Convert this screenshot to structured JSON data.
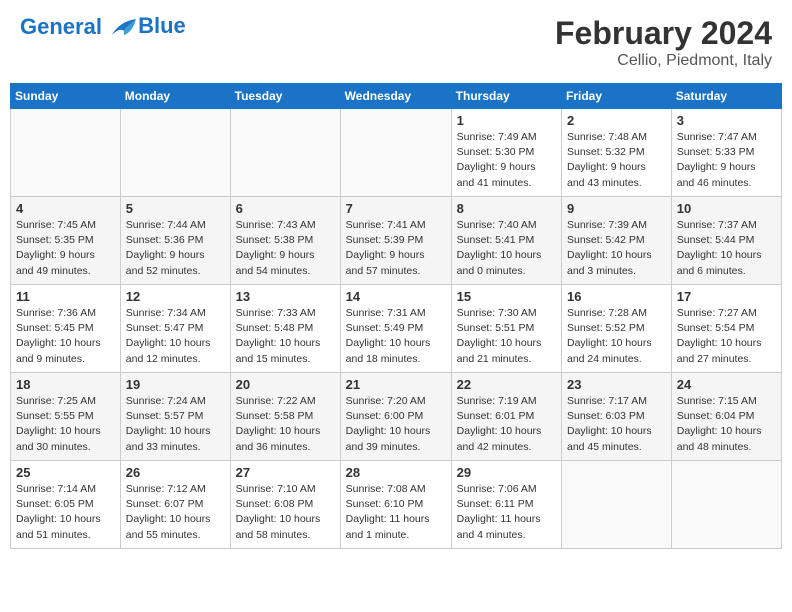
{
  "header": {
    "logo_line1": "General",
    "logo_line2": "Blue",
    "month": "February 2024",
    "location": "Cellio, Piedmont, Italy"
  },
  "days_of_week": [
    "Sunday",
    "Monday",
    "Tuesday",
    "Wednesday",
    "Thursday",
    "Friday",
    "Saturday"
  ],
  "weeks": [
    [
      {
        "day": "",
        "info": ""
      },
      {
        "day": "",
        "info": ""
      },
      {
        "day": "",
        "info": ""
      },
      {
        "day": "",
        "info": ""
      },
      {
        "day": "1",
        "info": "Sunrise: 7:49 AM\nSunset: 5:30 PM\nDaylight: 9 hours\nand 41 minutes."
      },
      {
        "day": "2",
        "info": "Sunrise: 7:48 AM\nSunset: 5:32 PM\nDaylight: 9 hours\nand 43 minutes."
      },
      {
        "day": "3",
        "info": "Sunrise: 7:47 AM\nSunset: 5:33 PM\nDaylight: 9 hours\nand 46 minutes."
      }
    ],
    [
      {
        "day": "4",
        "info": "Sunrise: 7:45 AM\nSunset: 5:35 PM\nDaylight: 9 hours\nand 49 minutes."
      },
      {
        "day": "5",
        "info": "Sunrise: 7:44 AM\nSunset: 5:36 PM\nDaylight: 9 hours\nand 52 minutes."
      },
      {
        "day": "6",
        "info": "Sunrise: 7:43 AM\nSunset: 5:38 PM\nDaylight: 9 hours\nand 54 minutes."
      },
      {
        "day": "7",
        "info": "Sunrise: 7:41 AM\nSunset: 5:39 PM\nDaylight: 9 hours\nand 57 minutes."
      },
      {
        "day": "8",
        "info": "Sunrise: 7:40 AM\nSunset: 5:41 PM\nDaylight: 10 hours\nand 0 minutes."
      },
      {
        "day": "9",
        "info": "Sunrise: 7:39 AM\nSunset: 5:42 PM\nDaylight: 10 hours\nand 3 minutes."
      },
      {
        "day": "10",
        "info": "Sunrise: 7:37 AM\nSunset: 5:44 PM\nDaylight: 10 hours\nand 6 minutes."
      }
    ],
    [
      {
        "day": "11",
        "info": "Sunrise: 7:36 AM\nSunset: 5:45 PM\nDaylight: 10 hours\nand 9 minutes."
      },
      {
        "day": "12",
        "info": "Sunrise: 7:34 AM\nSunset: 5:47 PM\nDaylight: 10 hours\nand 12 minutes."
      },
      {
        "day": "13",
        "info": "Sunrise: 7:33 AM\nSunset: 5:48 PM\nDaylight: 10 hours\nand 15 minutes."
      },
      {
        "day": "14",
        "info": "Sunrise: 7:31 AM\nSunset: 5:49 PM\nDaylight: 10 hours\nand 18 minutes."
      },
      {
        "day": "15",
        "info": "Sunrise: 7:30 AM\nSunset: 5:51 PM\nDaylight: 10 hours\nand 21 minutes."
      },
      {
        "day": "16",
        "info": "Sunrise: 7:28 AM\nSunset: 5:52 PM\nDaylight: 10 hours\nand 24 minutes."
      },
      {
        "day": "17",
        "info": "Sunrise: 7:27 AM\nSunset: 5:54 PM\nDaylight: 10 hours\nand 27 minutes."
      }
    ],
    [
      {
        "day": "18",
        "info": "Sunrise: 7:25 AM\nSunset: 5:55 PM\nDaylight: 10 hours\nand 30 minutes."
      },
      {
        "day": "19",
        "info": "Sunrise: 7:24 AM\nSunset: 5:57 PM\nDaylight: 10 hours\nand 33 minutes."
      },
      {
        "day": "20",
        "info": "Sunrise: 7:22 AM\nSunset: 5:58 PM\nDaylight: 10 hours\nand 36 minutes."
      },
      {
        "day": "21",
        "info": "Sunrise: 7:20 AM\nSunset: 6:00 PM\nDaylight: 10 hours\nand 39 minutes."
      },
      {
        "day": "22",
        "info": "Sunrise: 7:19 AM\nSunset: 6:01 PM\nDaylight: 10 hours\nand 42 minutes."
      },
      {
        "day": "23",
        "info": "Sunrise: 7:17 AM\nSunset: 6:03 PM\nDaylight: 10 hours\nand 45 minutes."
      },
      {
        "day": "24",
        "info": "Sunrise: 7:15 AM\nSunset: 6:04 PM\nDaylight: 10 hours\nand 48 minutes."
      }
    ],
    [
      {
        "day": "25",
        "info": "Sunrise: 7:14 AM\nSunset: 6:05 PM\nDaylight: 10 hours\nand 51 minutes."
      },
      {
        "day": "26",
        "info": "Sunrise: 7:12 AM\nSunset: 6:07 PM\nDaylight: 10 hours\nand 55 minutes."
      },
      {
        "day": "27",
        "info": "Sunrise: 7:10 AM\nSunset: 6:08 PM\nDaylight: 10 hours\nand 58 minutes."
      },
      {
        "day": "28",
        "info": "Sunrise: 7:08 AM\nSunset: 6:10 PM\nDaylight: 11 hours\nand 1 minute."
      },
      {
        "day": "29",
        "info": "Sunrise: 7:06 AM\nSunset: 6:11 PM\nDaylight: 11 hours\nand 4 minutes."
      },
      {
        "day": "",
        "info": ""
      },
      {
        "day": "",
        "info": ""
      }
    ]
  ]
}
